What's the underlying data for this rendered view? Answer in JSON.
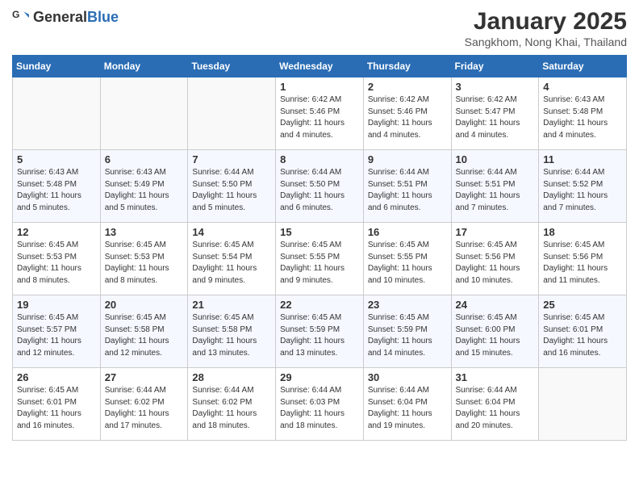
{
  "header": {
    "logo_general": "General",
    "logo_blue": "Blue",
    "month_year": "January 2025",
    "location": "Sangkhom, Nong Khai, Thailand"
  },
  "weekdays": [
    "Sunday",
    "Monday",
    "Tuesday",
    "Wednesday",
    "Thursday",
    "Friday",
    "Saturday"
  ],
  "weeks": [
    [
      {
        "day": "",
        "sunrise": "",
        "sunset": "",
        "daylight": ""
      },
      {
        "day": "",
        "sunrise": "",
        "sunset": "",
        "daylight": ""
      },
      {
        "day": "",
        "sunrise": "",
        "sunset": "",
        "daylight": ""
      },
      {
        "day": "1",
        "sunrise": "Sunrise: 6:42 AM",
        "sunset": "Sunset: 5:46 PM",
        "daylight": "Daylight: 11 hours and 4 minutes."
      },
      {
        "day": "2",
        "sunrise": "Sunrise: 6:42 AM",
        "sunset": "Sunset: 5:46 PM",
        "daylight": "Daylight: 11 hours and 4 minutes."
      },
      {
        "day": "3",
        "sunrise": "Sunrise: 6:42 AM",
        "sunset": "Sunset: 5:47 PM",
        "daylight": "Daylight: 11 hours and 4 minutes."
      },
      {
        "day": "4",
        "sunrise": "Sunrise: 6:43 AM",
        "sunset": "Sunset: 5:48 PM",
        "daylight": "Daylight: 11 hours and 4 minutes."
      }
    ],
    [
      {
        "day": "5",
        "sunrise": "Sunrise: 6:43 AM",
        "sunset": "Sunset: 5:48 PM",
        "daylight": "Daylight: 11 hours and 5 minutes."
      },
      {
        "day": "6",
        "sunrise": "Sunrise: 6:43 AM",
        "sunset": "Sunset: 5:49 PM",
        "daylight": "Daylight: 11 hours and 5 minutes."
      },
      {
        "day": "7",
        "sunrise": "Sunrise: 6:44 AM",
        "sunset": "Sunset: 5:50 PM",
        "daylight": "Daylight: 11 hours and 5 minutes."
      },
      {
        "day": "8",
        "sunrise": "Sunrise: 6:44 AM",
        "sunset": "Sunset: 5:50 PM",
        "daylight": "Daylight: 11 hours and 6 minutes."
      },
      {
        "day": "9",
        "sunrise": "Sunrise: 6:44 AM",
        "sunset": "Sunset: 5:51 PM",
        "daylight": "Daylight: 11 hours and 6 minutes."
      },
      {
        "day": "10",
        "sunrise": "Sunrise: 6:44 AM",
        "sunset": "Sunset: 5:51 PM",
        "daylight": "Daylight: 11 hours and 7 minutes."
      },
      {
        "day": "11",
        "sunrise": "Sunrise: 6:44 AM",
        "sunset": "Sunset: 5:52 PM",
        "daylight": "Daylight: 11 hours and 7 minutes."
      }
    ],
    [
      {
        "day": "12",
        "sunrise": "Sunrise: 6:45 AM",
        "sunset": "Sunset: 5:53 PM",
        "daylight": "Daylight: 11 hours and 8 minutes."
      },
      {
        "day": "13",
        "sunrise": "Sunrise: 6:45 AM",
        "sunset": "Sunset: 5:53 PM",
        "daylight": "Daylight: 11 hours and 8 minutes."
      },
      {
        "day": "14",
        "sunrise": "Sunrise: 6:45 AM",
        "sunset": "Sunset: 5:54 PM",
        "daylight": "Daylight: 11 hours and 9 minutes."
      },
      {
        "day": "15",
        "sunrise": "Sunrise: 6:45 AM",
        "sunset": "Sunset: 5:55 PM",
        "daylight": "Daylight: 11 hours and 9 minutes."
      },
      {
        "day": "16",
        "sunrise": "Sunrise: 6:45 AM",
        "sunset": "Sunset: 5:55 PM",
        "daylight": "Daylight: 11 hours and 10 minutes."
      },
      {
        "day": "17",
        "sunrise": "Sunrise: 6:45 AM",
        "sunset": "Sunset: 5:56 PM",
        "daylight": "Daylight: 11 hours and 10 minutes."
      },
      {
        "day": "18",
        "sunrise": "Sunrise: 6:45 AM",
        "sunset": "Sunset: 5:56 PM",
        "daylight": "Daylight: 11 hours and 11 minutes."
      }
    ],
    [
      {
        "day": "19",
        "sunrise": "Sunrise: 6:45 AM",
        "sunset": "Sunset: 5:57 PM",
        "daylight": "Daylight: 11 hours and 12 minutes."
      },
      {
        "day": "20",
        "sunrise": "Sunrise: 6:45 AM",
        "sunset": "Sunset: 5:58 PM",
        "daylight": "Daylight: 11 hours and 12 minutes."
      },
      {
        "day": "21",
        "sunrise": "Sunrise: 6:45 AM",
        "sunset": "Sunset: 5:58 PM",
        "daylight": "Daylight: 11 hours and 13 minutes."
      },
      {
        "day": "22",
        "sunrise": "Sunrise: 6:45 AM",
        "sunset": "Sunset: 5:59 PM",
        "daylight": "Daylight: 11 hours and 13 minutes."
      },
      {
        "day": "23",
        "sunrise": "Sunrise: 6:45 AM",
        "sunset": "Sunset: 5:59 PM",
        "daylight": "Daylight: 11 hours and 14 minutes."
      },
      {
        "day": "24",
        "sunrise": "Sunrise: 6:45 AM",
        "sunset": "Sunset: 6:00 PM",
        "daylight": "Daylight: 11 hours and 15 minutes."
      },
      {
        "day": "25",
        "sunrise": "Sunrise: 6:45 AM",
        "sunset": "Sunset: 6:01 PM",
        "daylight": "Daylight: 11 hours and 16 minutes."
      }
    ],
    [
      {
        "day": "26",
        "sunrise": "Sunrise: 6:45 AM",
        "sunset": "Sunset: 6:01 PM",
        "daylight": "Daylight: 11 hours and 16 minutes."
      },
      {
        "day": "27",
        "sunrise": "Sunrise: 6:44 AM",
        "sunset": "Sunset: 6:02 PM",
        "daylight": "Daylight: 11 hours and 17 minutes."
      },
      {
        "day": "28",
        "sunrise": "Sunrise: 6:44 AM",
        "sunset": "Sunset: 6:02 PM",
        "daylight": "Daylight: 11 hours and 18 minutes."
      },
      {
        "day": "29",
        "sunrise": "Sunrise: 6:44 AM",
        "sunset": "Sunset: 6:03 PM",
        "daylight": "Daylight: 11 hours and 18 minutes."
      },
      {
        "day": "30",
        "sunrise": "Sunrise: 6:44 AM",
        "sunset": "Sunset: 6:04 PM",
        "daylight": "Daylight: 11 hours and 19 minutes."
      },
      {
        "day": "31",
        "sunrise": "Sunrise: 6:44 AM",
        "sunset": "Sunset: 6:04 PM",
        "daylight": "Daylight: 11 hours and 20 minutes."
      },
      {
        "day": "",
        "sunrise": "",
        "sunset": "",
        "daylight": ""
      }
    ]
  ]
}
